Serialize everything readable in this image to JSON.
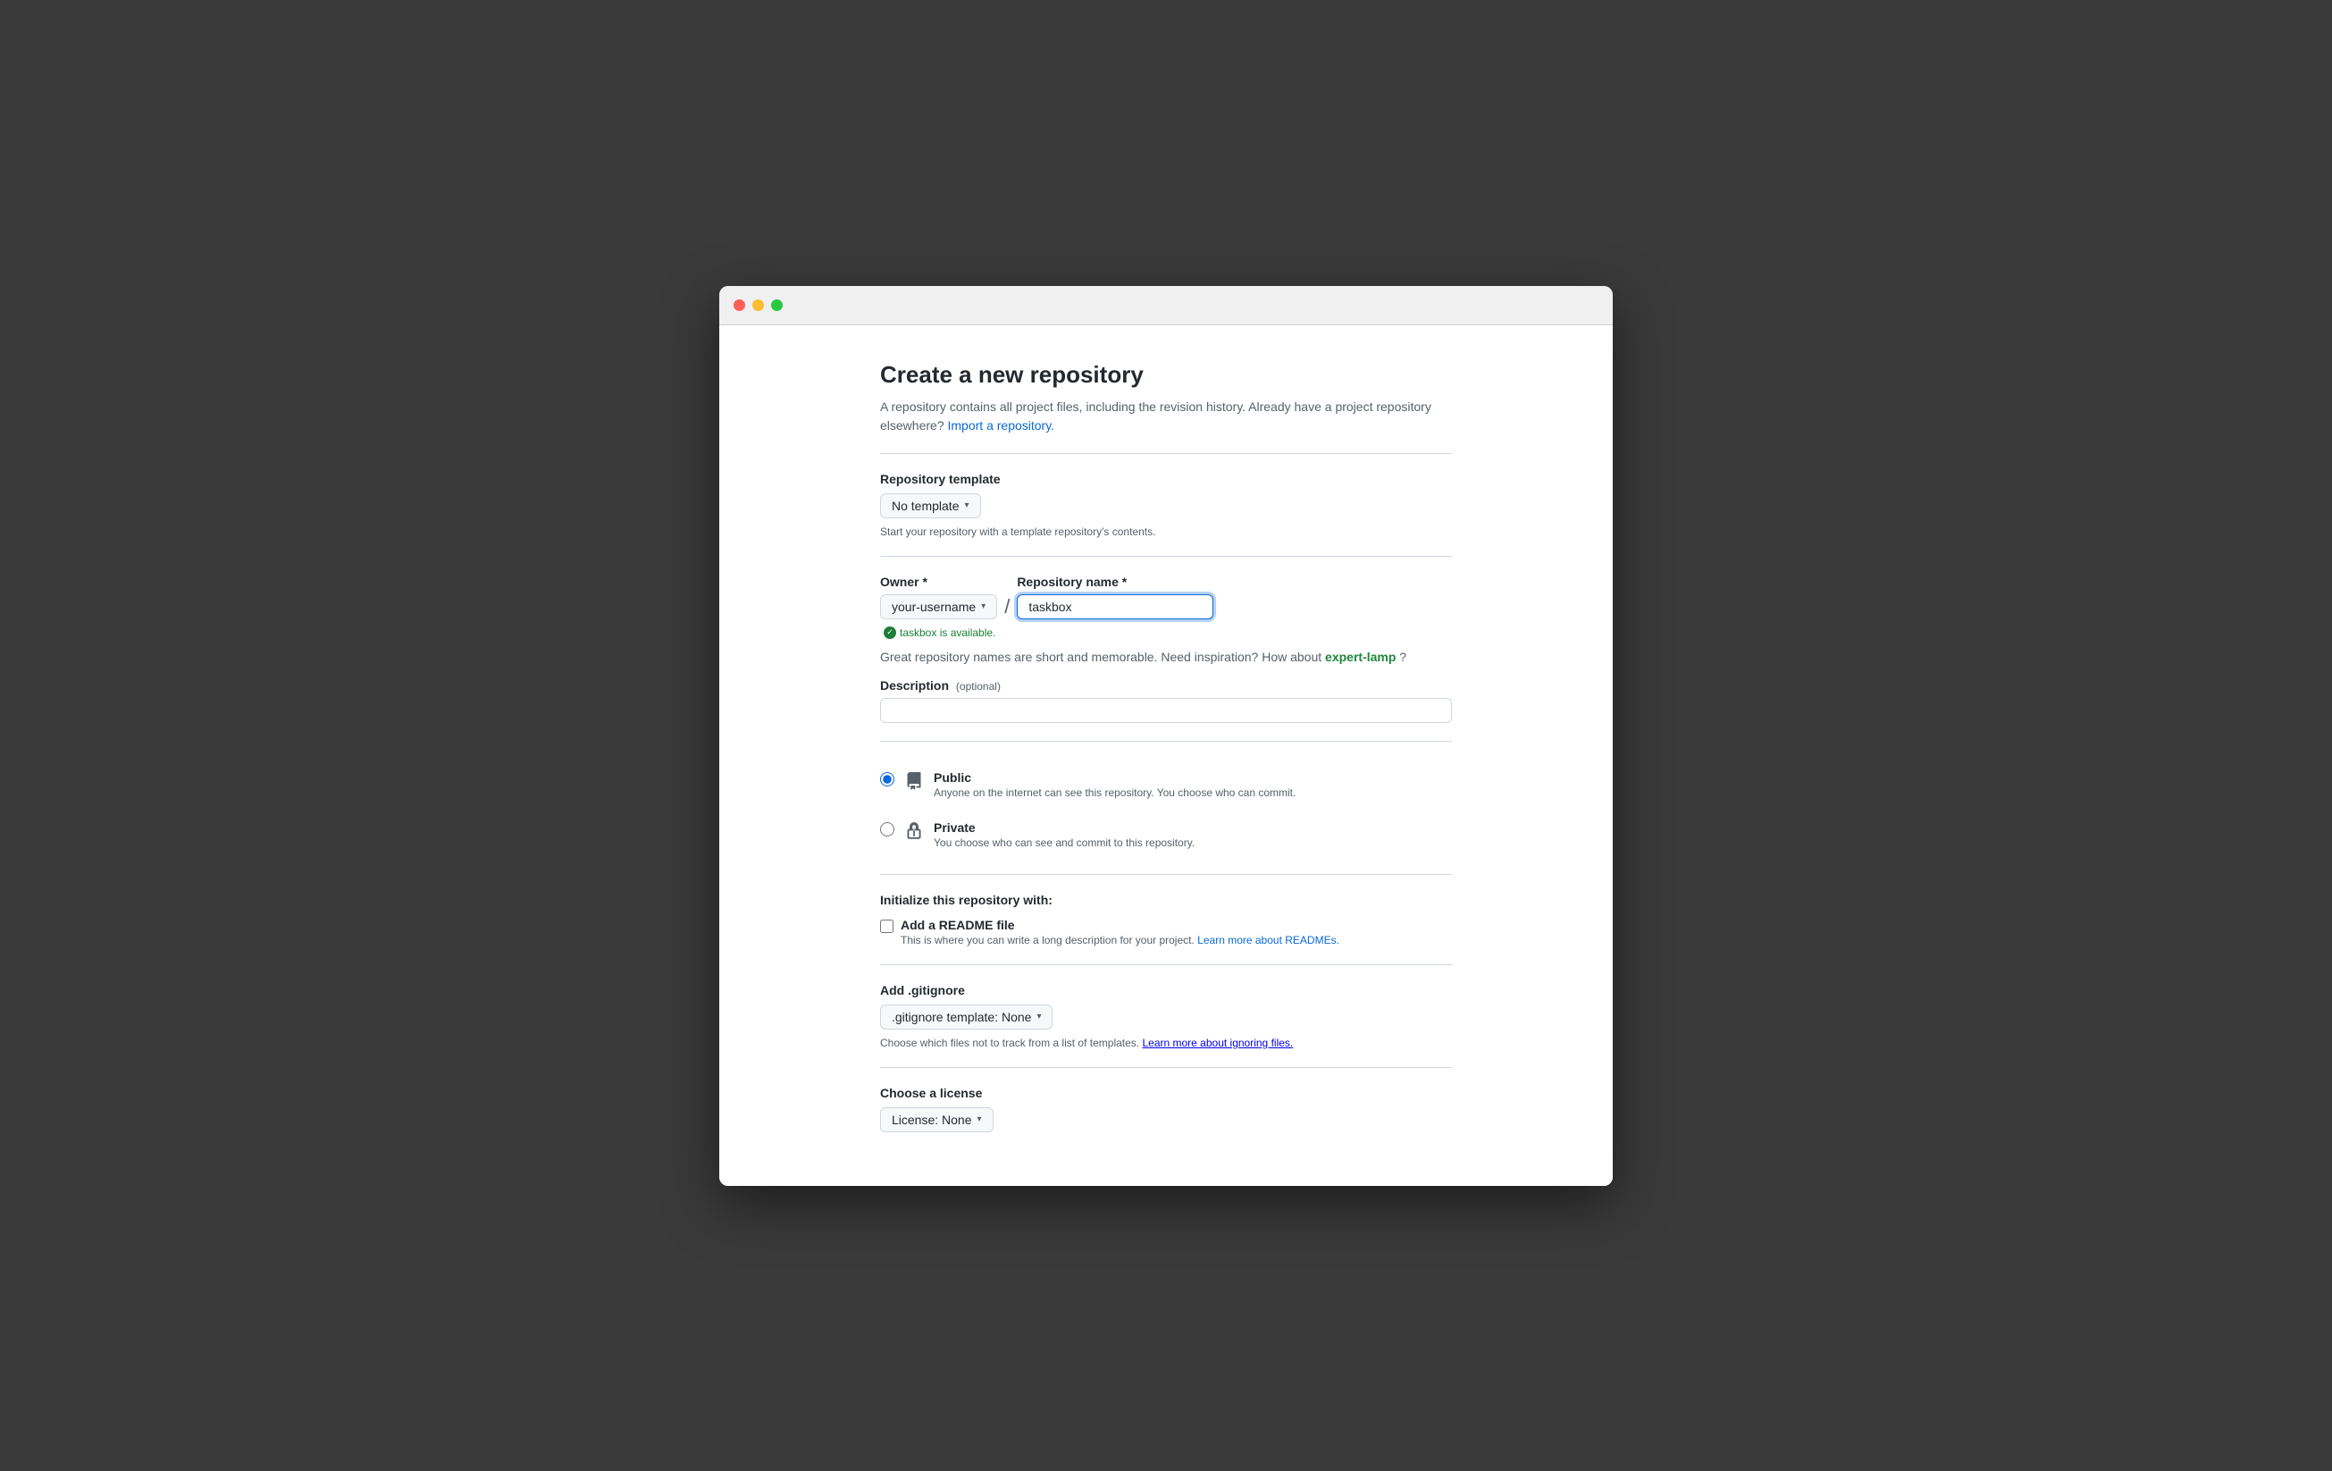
{
  "window": {
    "title": "Create a new repository"
  },
  "page": {
    "heading": "Create a new repository",
    "description_part1": "A repository contains all project files, including the revision history. Already have a project repository elsewhere?",
    "import_link": "Import a repository.",
    "import_href": "#"
  },
  "template_section": {
    "label": "Repository template",
    "dropdown_value": "No template",
    "hint": "Start your repository with a template repository's contents."
  },
  "owner_section": {
    "label": "Owner *",
    "dropdown_value": "your-username"
  },
  "repo_name_section": {
    "label": "Repository name *",
    "value": "taskbox",
    "placeholder": ""
  },
  "availability": {
    "message": "taskbox is available."
  },
  "inspiration": {
    "text_before": "Great repository names are short and memorable. Need inspiration? How about",
    "link": "expert-lamp",
    "text_after": "?"
  },
  "description_section": {
    "label": "Description",
    "optional_label": "(optional)",
    "placeholder": ""
  },
  "visibility": {
    "public": {
      "title": "Public",
      "description": "Anyone on the internet can see this repository. You choose who can commit."
    },
    "private": {
      "title": "Private",
      "description": "You choose who can see and commit to this repository."
    }
  },
  "init_section": {
    "title": "Initialize this repository with:",
    "readme": {
      "label": "Add a README file",
      "description_part1": "This is where you can write a long description for your project.",
      "learn_more_link": "Learn more about READMEs.",
      "learn_more_href": "#"
    }
  },
  "gitignore_section": {
    "title": "Add .gitignore",
    "dropdown_value": ".gitignore template: None",
    "hint_part1": "Choose which files not to track from a list of templates.",
    "learn_more_link": "Learn more about ignoring files.",
    "learn_more_href": "#"
  },
  "license_section": {
    "title": "Choose a license",
    "dropdown_value": "License: None"
  },
  "colors": {
    "blue": "#0969da",
    "green": "#1a7f37",
    "border": "#d0d7de",
    "text_muted": "#57606a"
  }
}
